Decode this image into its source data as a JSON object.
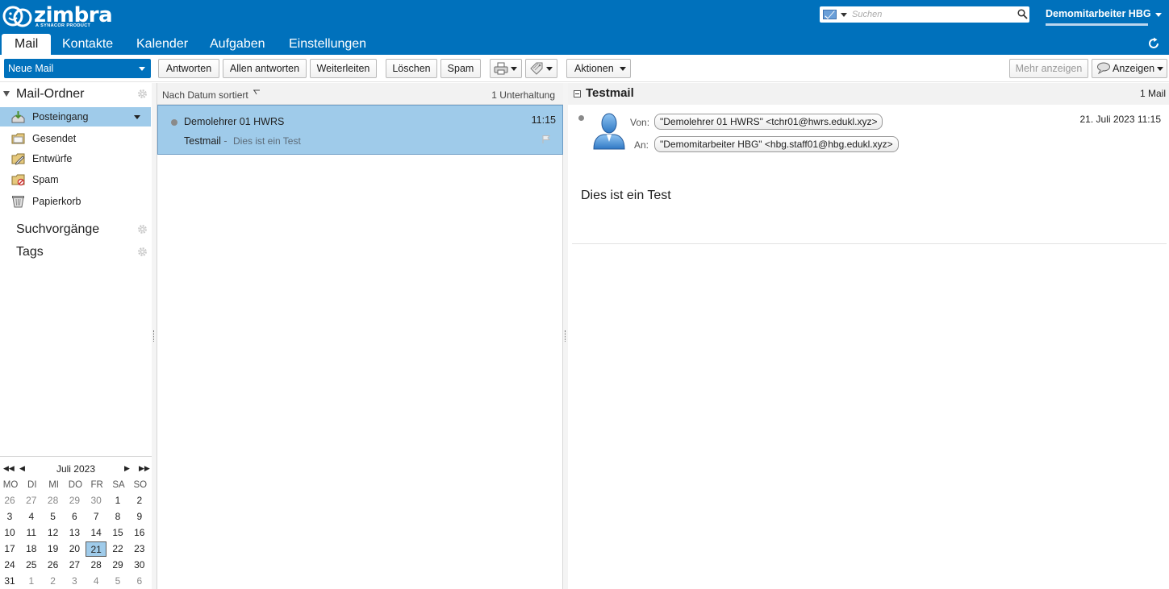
{
  "brand": {
    "logo_text": "zimbra",
    "logo_sub": "A SYNACOR PRODUCT"
  },
  "search": {
    "placeholder": "Suchen"
  },
  "user": {
    "name": "Demomitarbeiter HBG"
  },
  "apptabs": [
    {
      "label": "Mail",
      "active": true
    },
    {
      "label": "Kontakte"
    },
    {
      "label": "Kalender"
    },
    {
      "label": "Aufgaben"
    },
    {
      "label": "Einstellungen"
    }
  ],
  "toolbar": {
    "new_mail": "Neue Mail",
    "reply": "Antworten",
    "reply_all": "Allen antworten",
    "forward": "Weiterleiten",
    "delete": "Löschen",
    "spam": "Spam",
    "actions": "Aktionen",
    "show_more": "Mehr anzeigen",
    "view": "Anzeigen"
  },
  "sidebar": {
    "mail_folders": "Mail-Ordner",
    "folders": [
      {
        "label": "Posteingang",
        "icon": "inbox-icon",
        "selected": true
      },
      {
        "label": "Gesendet",
        "icon": "sent-icon"
      },
      {
        "label": "Entwürfe",
        "icon": "drafts-icon"
      },
      {
        "label": "Spam",
        "icon": "spam-folder-icon"
      },
      {
        "label": "Papierkorb",
        "icon": "trash-icon"
      }
    ],
    "searches": "Suchvorgänge",
    "tags": "Tags"
  },
  "calendar": {
    "month": "Juli 2023",
    "weekdays": [
      "MO",
      "DI",
      "MI",
      "DO",
      "FR",
      "SA",
      "SO"
    ],
    "weeks": [
      [
        "26",
        "27",
        "28",
        "29",
        "30",
        "1",
        "2"
      ],
      [
        "3",
        "4",
        "5",
        "6",
        "7",
        "8",
        "9"
      ],
      [
        "10",
        "11",
        "12",
        "13",
        "14",
        "15",
        "16"
      ],
      [
        "17",
        "18",
        "19",
        "20",
        "21",
        "22",
        "23"
      ],
      [
        "24",
        "25",
        "26",
        "27",
        "28",
        "29",
        "30"
      ],
      [
        "31",
        "1",
        "2",
        "3",
        "4",
        "5",
        "6"
      ]
    ],
    "today": "21"
  },
  "maillist": {
    "sort_label": "Nach Datum sortiert",
    "count": "1 Unterhaltung",
    "rows": [
      {
        "from": "Demolehrer 01 HWRS",
        "time": "11:15",
        "subject": "Testmail",
        "separator": " -",
        "fragment": "Dies ist ein Test"
      }
    ]
  },
  "reading": {
    "subject": "Testmail",
    "count": "1 Mail",
    "from_label": "Von:",
    "from": "\"Demolehrer 01 HWRS\" <tchr01@hwrs.edukl.xyz>",
    "to_label": "An:",
    "to": "\"Demomitarbeiter HBG\" <hbg.staff01@hbg.edukl.xyz>",
    "date": "21. Juli 2023 11:15",
    "body": "Dies ist ein Test"
  },
  "colors": {
    "brand": "#0071bc",
    "selection": "#9fcbea"
  }
}
